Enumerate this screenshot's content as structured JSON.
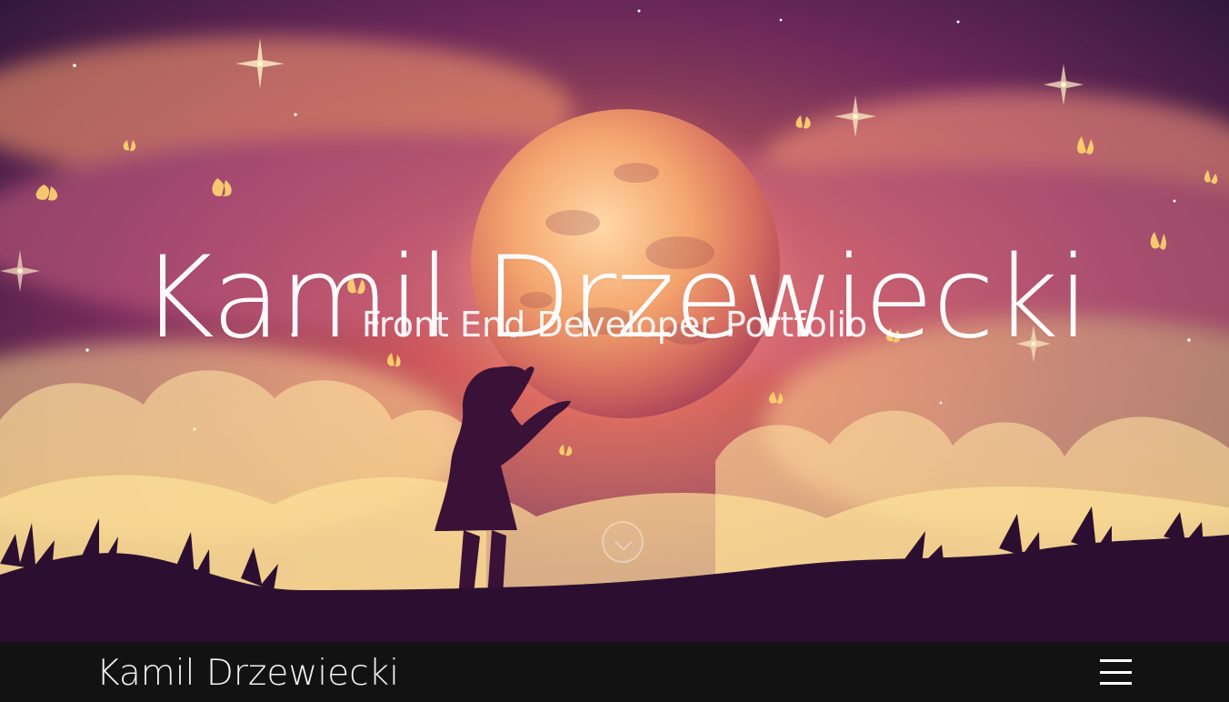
{
  "hero": {
    "title": "Kamil Drzewiecki",
    "subtitle": "Front End Developer Portfolio",
    "scroll_icon": "chevron-down-icon"
  },
  "navbar": {
    "brand": "Kamil Drzewiecki",
    "menu_icon": "hamburger-menu-icon"
  },
  "colors": {
    "navbar_background": "#121212",
    "text": "#ffffff",
    "sky_dark": "#261a3f",
    "sky_pink": "#b0445b",
    "glow": "#ffd98b"
  }
}
